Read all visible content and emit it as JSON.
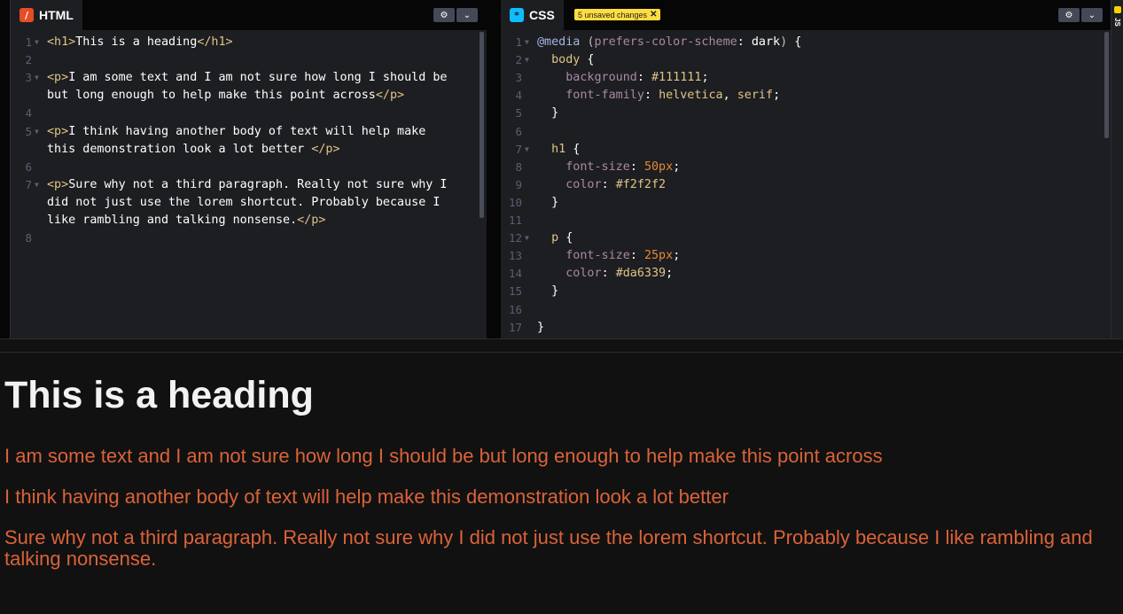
{
  "html_panel": {
    "title": "HTML",
    "logo": "/",
    "settings_icon": "gear-icon",
    "collapse_icon": "chevron-down-icon",
    "lines": [
      {
        "n": "1",
        "fold": true,
        "parts": [
          [
            "tag",
            "<h1>"
          ],
          [
            "plain",
            "This is a heading"
          ],
          [
            "tag",
            "</h1>"
          ]
        ]
      },
      {
        "n": "2",
        "fold": false,
        "parts": []
      },
      {
        "n": "3",
        "fold": true,
        "parts": [
          [
            "tag",
            "<p>"
          ],
          [
            "plain",
            "I am some text and I am not sure how long I should be"
          ]
        ]
      },
      {
        "n": "",
        "fold": false,
        "parts": [
          [
            "plain",
            "but long enough to help make this point across"
          ],
          [
            "tag",
            "</p>"
          ]
        ]
      },
      {
        "n": "4",
        "fold": false,
        "parts": []
      },
      {
        "n": "5",
        "fold": true,
        "parts": [
          [
            "tag",
            "<p>"
          ],
          [
            "plain",
            "I think having another body of text will help make"
          ]
        ]
      },
      {
        "n": "",
        "fold": false,
        "parts": [
          [
            "plain",
            "this demonstration look a lot better "
          ],
          [
            "tag",
            "</p>"
          ]
        ]
      },
      {
        "n": "6",
        "fold": false,
        "parts": []
      },
      {
        "n": "7",
        "fold": true,
        "parts": [
          [
            "tag",
            "<p>"
          ],
          [
            "plain",
            "Sure why not a third paragraph. Really not sure why I"
          ]
        ]
      },
      {
        "n": "",
        "fold": false,
        "parts": [
          [
            "plain",
            "did not just use the lorem shortcut. Probably because I"
          ]
        ]
      },
      {
        "n": "",
        "fold": false,
        "parts": [
          [
            "plain",
            "like rambling and talking nonsense."
          ],
          [
            "tag",
            "</p>"
          ]
        ]
      },
      {
        "n": "8",
        "fold": false,
        "parts": []
      }
    ]
  },
  "css_panel": {
    "title": "CSS",
    "logo": "*",
    "unsaved_badge": "5 unsaved changes",
    "unsaved_close": "✕",
    "settings_icon": "gear-icon",
    "collapse_icon": "chevron-down-icon",
    "lines": [
      {
        "n": "1",
        "fold": true,
        "parts": [
          [
            "at",
            "@media"
          ],
          [
            "plain",
            " "
          ],
          [
            "paren",
            "("
          ],
          [
            "prop",
            "prefers-color-scheme"
          ],
          [
            "plain",
            ": "
          ],
          [
            "plain",
            "dark"
          ],
          [
            "paren",
            ")"
          ],
          [
            "plain",
            " {"
          ]
        ]
      },
      {
        "n": "2",
        "fold": true,
        "parts": [
          [
            "plain",
            "  "
          ],
          [
            "sel",
            "body"
          ],
          [
            "plain",
            " {"
          ]
        ]
      },
      {
        "n": "3",
        "fold": false,
        "parts": [
          [
            "plain",
            "    "
          ],
          [
            "prop",
            "background"
          ],
          [
            "plain",
            ": "
          ],
          [
            "val",
            "#111111"
          ],
          [
            "plain",
            ";"
          ]
        ]
      },
      {
        "n": "4",
        "fold": false,
        "parts": [
          [
            "plain",
            "    "
          ],
          [
            "prop",
            "font-family"
          ],
          [
            "plain",
            ": "
          ],
          [
            "val",
            "helvetica"
          ],
          [
            "plain",
            ", "
          ],
          [
            "val",
            "serif"
          ],
          [
            "plain",
            ";"
          ]
        ]
      },
      {
        "n": "5",
        "fold": false,
        "parts": [
          [
            "plain",
            "  }"
          ]
        ]
      },
      {
        "n": "6",
        "fold": false,
        "parts": []
      },
      {
        "n": "7",
        "fold": true,
        "parts": [
          [
            "plain",
            "  "
          ],
          [
            "sel",
            "h1"
          ],
          [
            "plain",
            " {"
          ]
        ]
      },
      {
        "n": "8",
        "fold": false,
        "parts": [
          [
            "plain",
            "    "
          ],
          [
            "prop",
            "font-size"
          ],
          [
            "plain",
            ": "
          ],
          [
            "num",
            "50px"
          ],
          [
            "plain",
            ";"
          ]
        ]
      },
      {
        "n": "9",
        "fold": false,
        "parts": [
          [
            "plain",
            "    "
          ],
          [
            "prop",
            "color"
          ],
          [
            "plain",
            ": "
          ],
          [
            "val",
            "#f2f2f2"
          ]
        ]
      },
      {
        "n": "10",
        "fold": false,
        "parts": [
          [
            "plain",
            "  }"
          ]
        ]
      },
      {
        "n": "11",
        "fold": false,
        "parts": []
      },
      {
        "n": "12",
        "fold": true,
        "parts": [
          [
            "plain",
            "  "
          ],
          [
            "sel",
            "p"
          ],
          [
            "plain",
            " {"
          ]
        ]
      },
      {
        "n": "13",
        "fold": false,
        "parts": [
          [
            "plain",
            "    "
          ],
          [
            "prop",
            "font-size"
          ],
          [
            "plain",
            ": "
          ],
          [
            "num",
            "25px"
          ],
          [
            "plain",
            ";"
          ]
        ]
      },
      {
        "n": "14",
        "fold": false,
        "parts": [
          [
            "plain",
            "    "
          ],
          [
            "prop",
            "color"
          ],
          [
            "plain",
            ": "
          ],
          [
            "val",
            "#da6339"
          ],
          [
            "plain",
            ";"
          ]
        ]
      },
      {
        "n": "15",
        "fold": false,
        "parts": [
          [
            "plain",
            "  }"
          ]
        ]
      },
      {
        "n": "16",
        "fold": false,
        "parts": []
      },
      {
        "n": "17",
        "fold": false,
        "parts": [
          [
            "plain",
            "}"
          ]
        ]
      }
    ]
  },
  "js_panel": {
    "label": "JS"
  },
  "preview": {
    "heading": "This is a heading",
    "paragraphs": [
      "I am some text and I am not sure how long I should be but long enough to help make this point across",
      "I think having another body of text will help make this demonstration look a lot better",
      "Sure why not a third paragraph. Really not sure why I did not just use the lorem shortcut. Probably because I like rambling and talking nonsense."
    ]
  },
  "colors": {
    "editor_bg": "#1d1e22",
    "preview_bg": "#111111",
    "heading": "#f2f2f2",
    "paragraph": "#da6339",
    "unsaved_badge": "#ffdd40"
  }
}
